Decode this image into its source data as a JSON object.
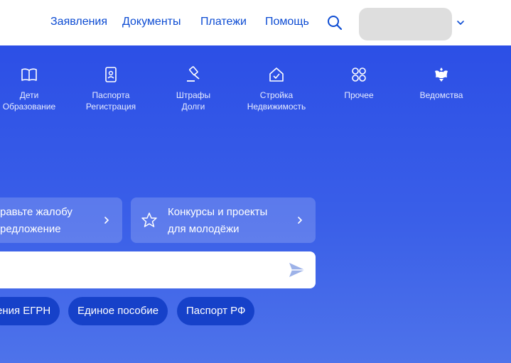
{
  "header": {
    "nav": [
      "Заявления",
      "Документы",
      "Платежи",
      "Помощь"
    ]
  },
  "categories": [
    {
      "icon": "book-icon",
      "line1": "Дети",
      "line2": "Образование"
    },
    {
      "icon": "passport-icon",
      "line1": "Паспорта",
      "line2": "Регистрация"
    },
    {
      "icon": "gavel-icon",
      "line1": "Штрафы",
      "line2": "Долги"
    },
    {
      "icon": "house-icon",
      "line1": "Стройка",
      "line2": "Недвижимость"
    },
    {
      "icon": "grid-icon",
      "line1": "Прочее",
      "line2": ""
    },
    {
      "icon": "emblem-icon",
      "line1": "Ведомства",
      "line2": ""
    }
  ],
  "cards": [
    {
      "line1": "равьте жалобу",
      "line2": "редложение"
    },
    {
      "icon": "star-icon",
      "line1": "Конкурсы и проекты",
      "line2": "для молодёжи"
    }
  ],
  "chips": [
    "ения ЕГРН",
    "Единое пособие",
    "Паспорт РФ"
  ],
  "colors": {
    "accent": "#0d4cd3",
    "hero": "#2c4fe6",
    "chip": "#1641c9"
  }
}
